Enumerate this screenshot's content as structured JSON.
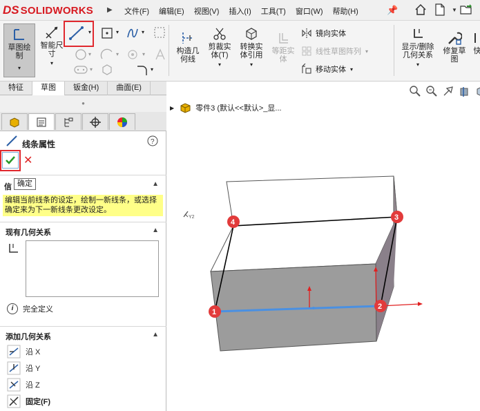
{
  "app": {
    "logo_ds": "DS",
    "logo_text": "SOLIDWORKS"
  },
  "menu": [
    "文件(F)",
    "编辑(E)",
    "视图(V)",
    "插入(I)",
    "工具(T)",
    "窗口(W)",
    "帮助(H)"
  ],
  "ribbon": {
    "sketch": "草图绘\n制",
    "smart_dim": "智能尺\n寸",
    "construct": "构造几\n何线",
    "trim": "剪裁实\n体(T)",
    "convert": "转换实\n体引用",
    "offset": "等距实\n体",
    "mirror": "镜向实体",
    "linear": "线性草图阵列",
    "move": "移动实体",
    "display_del": "显示/删除\n几何关系",
    "repair": "修复草\n图",
    "more": "快"
  },
  "tabs": [
    "特征",
    "草图",
    "钣金(H)",
    "曲面(E)"
  ],
  "panel": {
    "title": "线条属性",
    "tooltip": "确定",
    "msg_heading_char": "信",
    "message": "编辑当前线条的设定，绘制一新线条，或选择确定来为下一新线条更改设定。",
    "existing_title": "现有几何关系",
    "status": "完全定义",
    "add_title": "添加几何关系",
    "relations": [
      "沿 X",
      "沿 Y",
      "沿 Z",
      "固定(F)"
    ]
  },
  "viewport": {
    "tree_label": "零件3  (默认<<默认>_显...",
    "points": [
      "1",
      "2",
      "3",
      "4"
    ],
    "axis_mark": "Y2"
  }
}
